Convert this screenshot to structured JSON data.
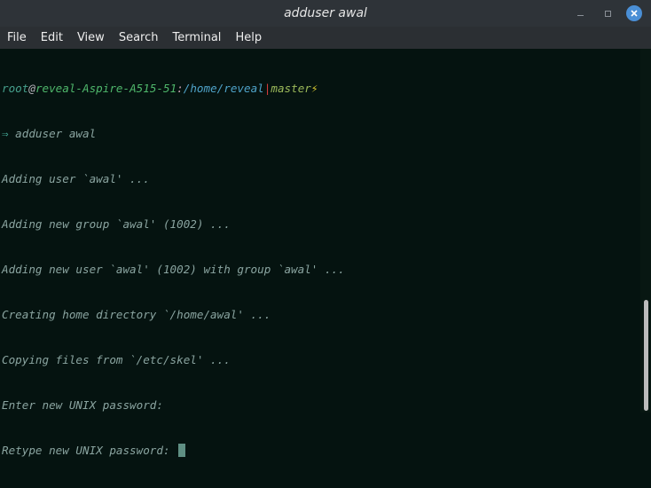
{
  "window": {
    "title": "adduser awal"
  },
  "menu": {
    "items": [
      "File",
      "Edit",
      "View",
      "Search",
      "Terminal",
      "Help"
    ]
  },
  "terminal": {
    "prompt": {
      "user": "root",
      "at": "@",
      "host": "reveal-Aspire-A515-51",
      "colon": ":",
      "path": "/home/reveal",
      "separator": "|",
      "branch": "master",
      "bolt": "⚡"
    },
    "command_arrow": "⇒",
    "command": " adduser awal",
    "output": [
      "Adding user `awal' ...",
      "Adding new group `awal' (1002) ...",
      "Adding new user `awal' (1002) with group `awal' ...",
      "Creating home directory `/home/awal' ...",
      "Copying files from `/etc/skel' ...",
      "Enter new UNIX password:",
      "Retype new UNIX password: "
    ]
  },
  "colors": {
    "background": "#051310",
    "titlebar": "#2e3338",
    "menubar": "#2b2f33",
    "text": "#8aa4a0",
    "close_button": "#4a8fd6"
  }
}
